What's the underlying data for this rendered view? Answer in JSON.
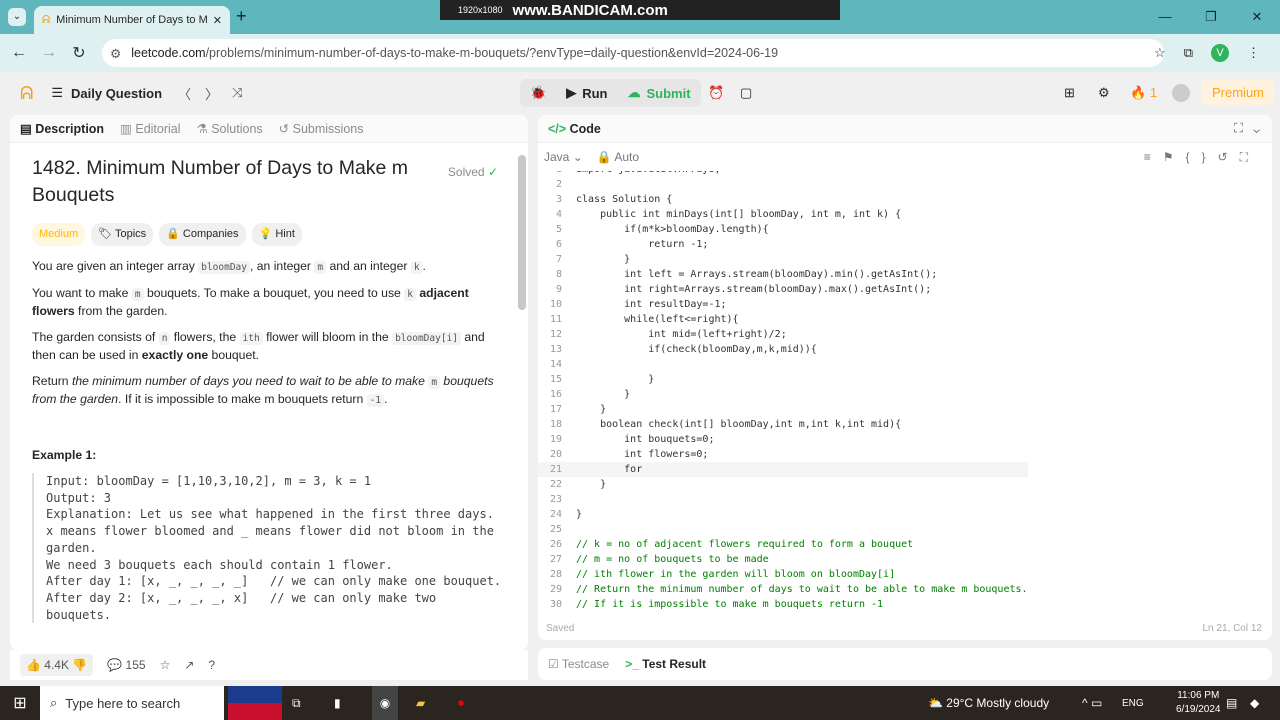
{
  "browser": {
    "tab_title": "Minimum Number of Days to M",
    "url_host": "leetcode.com",
    "url_path": "/problems/minimum-number-of-days-to-make-m-bouquets/?envType=daily-question&envId=2024-06-19"
  },
  "recorder": {
    "resolution": "1920x1080",
    "brand": "www.BANDICAM.com"
  },
  "lc_nav": {
    "daily": "Daily Question",
    "run": "Run",
    "submit": "Submit",
    "streak": "1",
    "premium": "Premium",
    "avatar": "V"
  },
  "left_tabs": [
    "Description",
    "Editorial",
    "Solutions",
    "Submissions"
  ],
  "problem": {
    "title": "1482. Minimum Number of Days to Make m Bouquets",
    "status": "Solved",
    "difficulty": "Medium",
    "tags": [
      "Topics",
      "Companies",
      "Hint"
    ],
    "paragraphs": [
      [
        {
          "t": "text",
          "v": "You are given an integer array "
        },
        {
          "t": "code",
          "v": "bloomDay"
        },
        {
          "t": "text",
          "v": ", an integer "
        },
        {
          "t": "code",
          "v": "m"
        },
        {
          "t": "text",
          "v": " and an integer "
        },
        {
          "t": "code",
          "v": "k"
        },
        {
          "t": "text",
          "v": "."
        }
      ],
      [
        {
          "t": "text",
          "v": "You want to make "
        },
        {
          "t": "code",
          "v": "m"
        },
        {
          "t": "text",
          "v": " bouquets. To make a bouquet, you need to use "
        },
        {
          "t": "code",
          "v": "k"
        },
        {
          "t": "text",
          "v": " "
        },
        {
          "t": "b",
          "v": "adjacent flowers"
        },
        {
          "t": "text",
          "v": " from the garden."
        }
      ],
      [
        {
          "t": "text",
          "v": "The garden consists of "
        },
        {
          "t": "code",
          "v": "n"
        },
        {
          "t": "text",
          "v": " flowers, the "
        },
        {
          "t": "code",
          "v": "ith"
        },
        {
          "t": "text",
          "v": " flower will bloom in the "
        },
        {
          "t": "code",
          "v": "bloomDay[i]"
        },
        {
          "t": "text",
          "v": " and then can be used in "
        },
        {
          "t": "b",
          "v": "exactly one"
        },
        {
          "t": "text",
          "v": " bouquet."
        }
      ],
      [
        {
          "t": "text",
          "v": "Return "
        },
        {
          "t": "i",
          "v": "the minimum number of days you need to wait to be able to make "
        },
        {
          "t": "code",
          "v": "m"
        },
        {
          "t": "i",
          "v": " bouquets from the garden"
        },
        {
          "t": "text",
          "v": ". If it is impossible to make m bouquets return "
        },
        {
          "t": "code",
          "v": "-1"
        },
        {
          "t": "text",
          "v": "."
        }
      ]
    ],
    "example_title": "Example 1:",
    "example": "Input: bloomDay = [1,10,3,10,2], m = 3, k = 1\nOutput: 3\nExplanation: Let us see what happened in the first three days.\nx means flower bloomed and _ means flower did not bloom in the\ngarden.\nWe need 3 bouquets each should contain 1 flower.\nAfter day 1: [x, _, _, _, _]   // we can only make one bouquet.\nAfter day 2: [x, _, _, _, x]   // we can only make two\nbouquets."
  },
  "footer": {
    "likes": "4.4K",
    "comments": "155"
  },
  "editor": {
    "title": "Code",
    "language": "Java",
    "mode": "Auto",
    "saved": "Saved",
    "cursor": "Ln 21, Col 12",
    "bottom_tabs": [
      "Testcase",
      "Test Result"
    ],
    "lines": [
      "import java.util.Arrays;",
      "",
      "class Solution {",
      "    public int minDays(int[] bloomDay, int m, int k) {",
      "        if(m*k>bloomDay.length){",
      "            return -1;",
      "        }",
      "        int left = Arrays.stream(bloomDay).min().getAsInt();",
      "        int right=Arrays.stream(bloomDay).max().getAsInt();",
      "        int resultDay=-1;",
      "        while(left<=right){",
      "            int mid=(left+right)/2;",
      "            if(check(bloomDay,m,k,mid)){",
      "",
      "            }",
      "        }",
      "    }",
      "    boolean check(int[] bloomDay,int m,int k,int mid){",
      "        int bouquets=0;",
      "        int flowers=0;",
      "        for",
      "    }",
      "",
      "}",
      "",
      "// k = no of adjacent flowers required to form a bouquet",
      "// m = no of bouquets to be made",
      "// ith flower in the garden will bloom on bloomDay[i]",
      "// Return the minimum number of days to wait to be able to make m bouquets.",
      "// If it is impossible to make m bouquets return -1"
    ]
  },
  "taskbar": {
    "search": "Type here to search",
    "weather": "29°C  Mostly cloudy",
    "lang": "ENG",
    "time": "11:06 PM",
    "date": "6/19/2024"
  },
  "colors": {
    "accent_green": "#2db55d",
    "medium": "#ffb800",
    "premium": "#ffa116",
    "tabbar": "#5fb7bd"
  }
}
